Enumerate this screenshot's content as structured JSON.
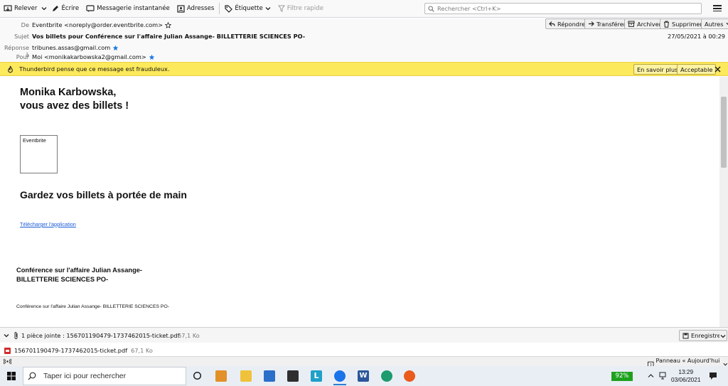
{
  "toolbar": {
    "relever": "Relever",
    "ecrire": "Écrire",
    "messagerie": "Messagerie instantanée",
    "adresses": "Adresses",
    "etiquette": "Étiquette",
    "filtre": "Filtre rapide",
    "search_placeholder": "Rechercher <Ctrl+K>"
  },
  "header": {
    "de_label": "De",
    "de_value": "Eventbrite <noreply@order.eventbrite.com>",
    "sujet_label": "Sujet",
    "sujet_value": "Vos billets pour Conférence sur l'affaire Julian Assange- BILLETTERIE SCIENCES PO-",
    "reponse_label": "Réponse à",
    "reponse_value": "tribunes.assas@gmail.com",
    "pour_label": "Pour",
    "pour_value": "Moi <monikakarbowska2@gmail.com>",
    "date": "27/05/2021 à 00:29",
    "buttons": {
      "repondre": "Répondre",
      "transferer": "Transférer",
      "archiver": "Archiver",
      "supprimer": "Supprimer",
      "autres": "Autres"
    }
  },
  "fraud": {
    "text": "Thunderbird pense que ce message est frauduleux.",
    "learn_more": "En savoir plus",
    "accept": "Acceptable"
  },
  "body": {
    "greeting_line1": "Monika Karbowska,",
    "greeting_line2": "vous avez des billets !",
    "image_alt": "Eventbrite",
    "keep_title": "Gardez vos billets à portée de main",
    "app_link": "Télécharger l'application",
    "event_title_line1": "Conférence sur l'affaire Julian Assange-",
    "event_title_line2": "BILLETTERIE SCIENCES PO-",
    "event_small": "Conférence sur l'affaire Julian Assange- BILLETTERIE SCIENCES PO-"
  },
  "attachments": {
    "summary": "1 pièce jointe : 156701190479-1737462015-ticket.pdf",
    "summary_size": "67,1 Ko",
    "save": "Enregistrer",
    "file_name": "156701190479-1737462015-ticket.pdf",
    "file_size": "67,1 Ko"
  },
  "status": {
    "panel": "Panneau « Aujourd'hui »"
  },
  "taskbar": {
    "search_placeholder": "Taper ici pour rechercher",
    "battery": "92%",
    "time": "13:29",
    "date": "03/06/2021"
  },
  "colors": {
    "fraud_bg": "#fde95c",
    "link": "#1a5bd6",
    "accent": "#2d7dd2"
  }
}
